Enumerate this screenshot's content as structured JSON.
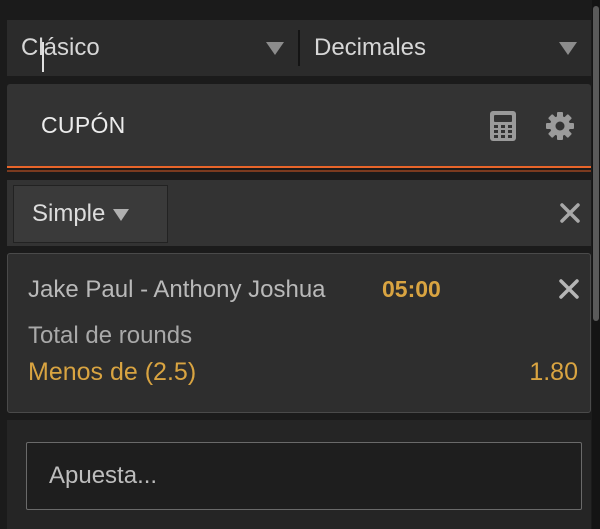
{
  "selectors": {
    "format": "Clásico",
    "odds_format": "Decimales"
  },
  "coupon": {
    "title": "CUPÓN",
    "accent_color": "#e8652a"
  },
  "bet_type": {
    "selected": "Simple"
  },
  "bet": {
    "match": "Jake Paul - Anthony Joshua",
    "time": "05:00",
    "market": "Total de rounds",
    "selection": "Menos de (2.5)",
    "odds": "1.80",
    "highlight_color": "#d9a441"
  },
  "stake": {
    "placeholder": "Apuesta...",
    "value": ""
  },
  "icons": {
    "calculator": "calculator-icon",
    "settings": "gear-icon",
    "close": "close-icon",
    "dropdown": "chevron-down-icon"
  }
}
